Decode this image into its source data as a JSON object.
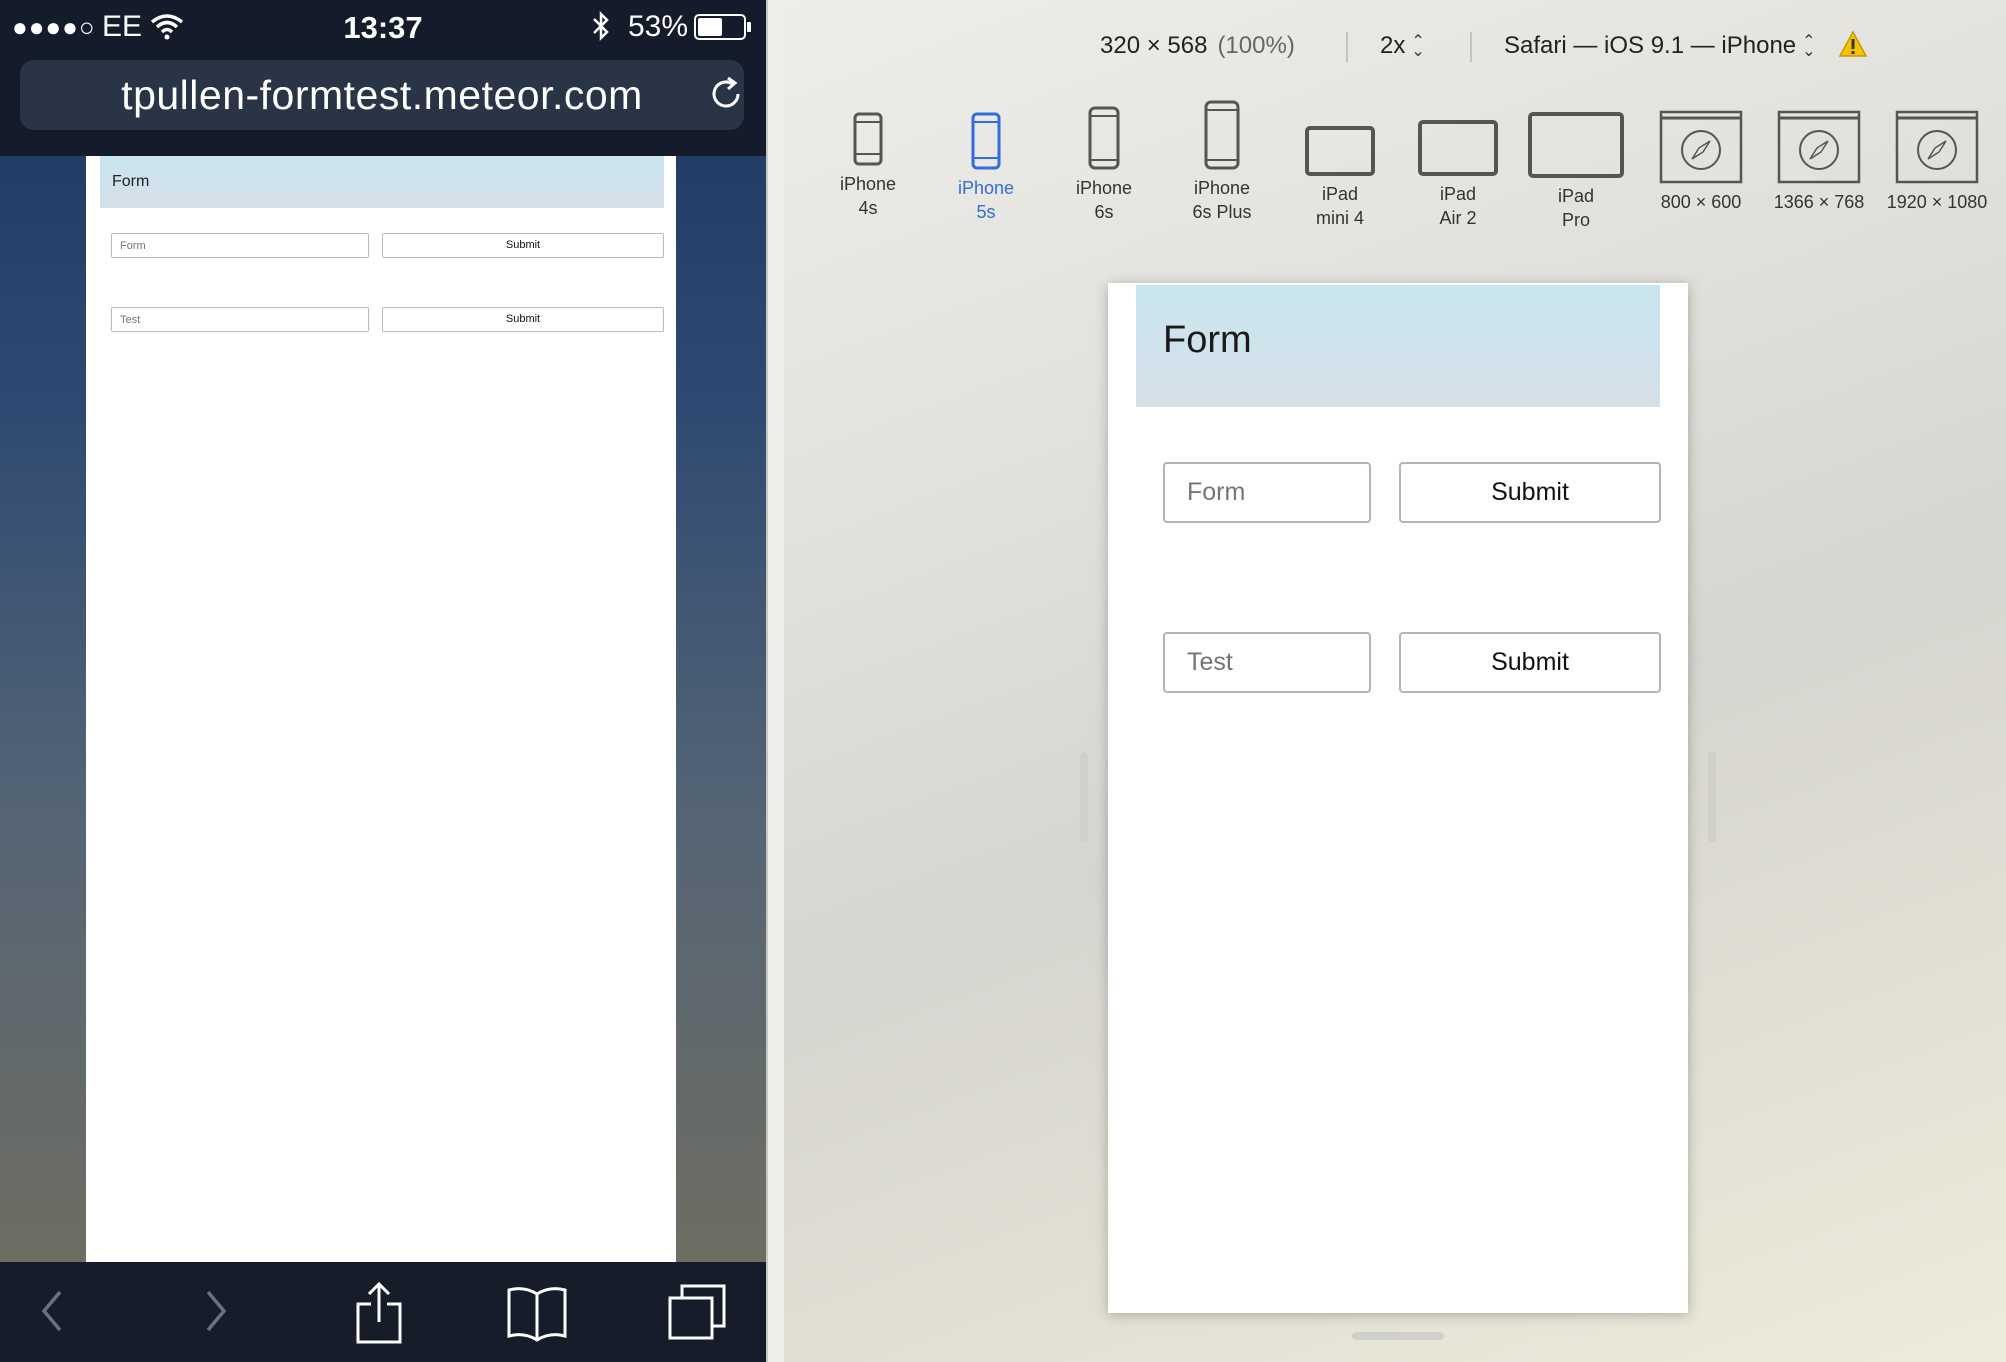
{
  "phone": {
    "status": {
      "signal": "●●●●○",
      "carrier": "EE",
      "time": "13:37",
      "battery": "53%"
    },
    "url": "tpullen-formtest.meteor.com",
    "page": {
      "header_title": "Form",
      "rows": [
        {
          "placeholder": "Form",
          "button": "Submit"
        },
        {
          "placeholder": "Test",
          "button": "Submit"
        }
      ]
    },
    "toolbar_icons": [
      "back-icon",
      "forward-icon",
      "share-icon",
      "bookmarks-icon",
      "tabs-icon"
    ]
  },
  "rdm": {
    "dimensions": "320 × 568",
    "zoom": "(100%)",
    "scale": "2x",
    "browser": "Safari — iOS 9.1 — iPhone",
    "devices": [
      {
        "line1": "iPhone",
        "line2": "4s",
        "active": false
      },
      {
        "line1": "iPhone",
        "line2": "5s",
        "active": true
      },
      {
        "line1": "iPhone",
        "line2": "6s",
        "active": false
      },
      {
        "line1": "iPhone",
        "line2": "6s Plus",
        "active": false
      },
      {
        "line1": "iPad",
        "line2": "mini 4",
        "active": false
      },
      {
        "line1": "iPad",
        "line2": "Air 2",
        "active": false
      },
      {
        "line1": "iPad",
        "line2": "Pro",
        "active": false
      },
      {
        "line1": "800 × 600",
        "line2": "",
        "active": false
      },
      {
        "line1": "1366 × 768",
        "line2": "",
        "active": false
      },
      {
        "line1": "1920 × 1080",
        "line2": "",
        "active": false
      }
    ],
    "page": {
      "header_title": "Form",
      "rows": [
        {
          "placeholder": "Form",
          "button": "Submit"
        },
        {
          "placeholder": "Test",
          "button": "Submit"
        }
      ]
    }
  },
  "colors": {
    "active_device": "#2f6de0",
    "header_gradient_top": "#c8e6ee",
    "header_gradient_bottom": "#d6dfe9"
  }
}
